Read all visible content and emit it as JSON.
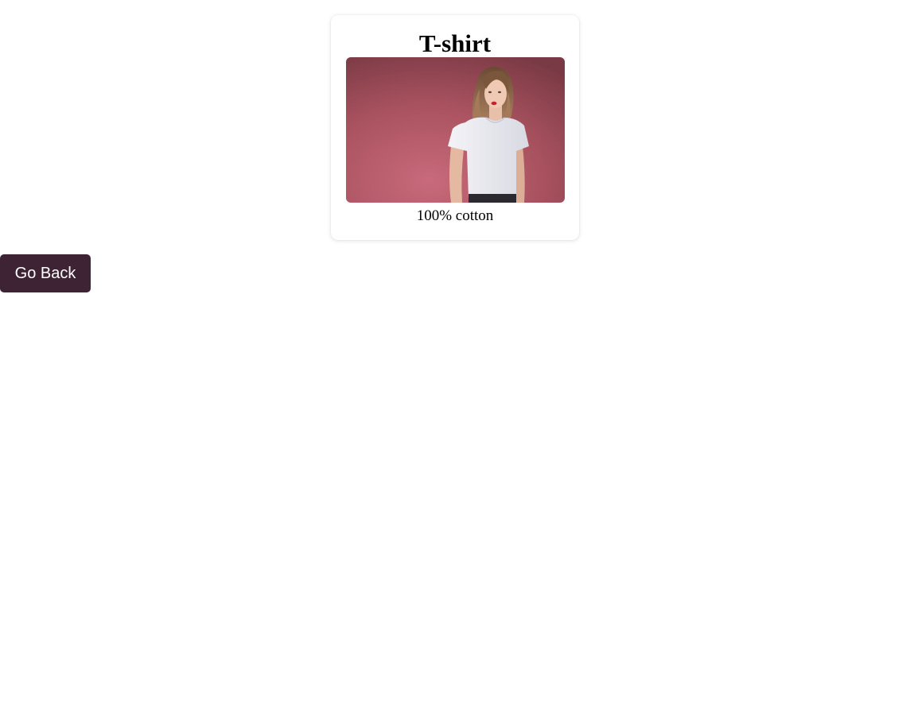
{
  "product": {
    "title": "T-shirt",
    "description": "100% cotton",
    "image_subject": "woman-in-white-tshirt-photo"
  },
  "actions": {
    "go_back_label": "Go Back"
  },
  "colors": {
    "button_bg": "#3d2333",
    "button_text": "#ffffff",
    "photo_background": "#b65a6a",
    "shirt": "#eeeef3"
  }
}
